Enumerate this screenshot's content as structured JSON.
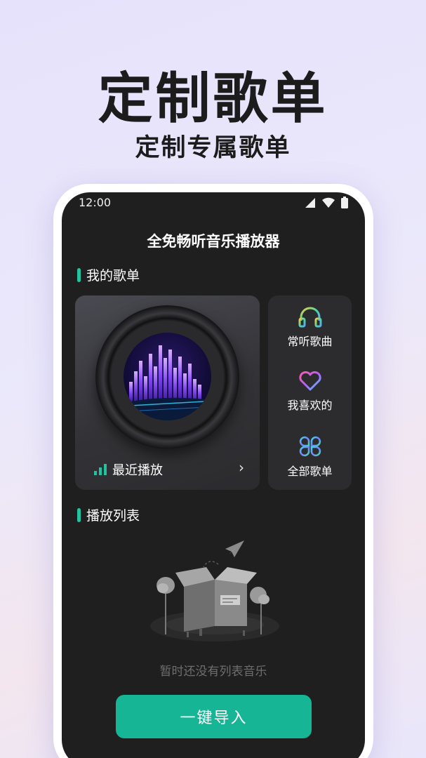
{
  "promo": {
    "headline": "定制歌单",
    "subheadline": "定制专属歌单"
  },
  "status_bar": {
    "time": "12:00",
    "icons": [
      "signal-icon",
      "wifi-icon",
      "battery-icon"
    ]
  },
  "app": {
    "title": "全免畅听音乐播放器"
  },
  "my_playlists": {
    "section_title": "我的歌单",
    "recent": {
      "label": "最近播放",
      "icon": "equalizer-bars-icon",
      "chevron": "›"
    },
    "quick_links": [
      {
        "label": "常听歌曲",
        "icon": "headphones-icon"
      },
      {
        "label": "我喜欢的",
        "icon": "heart-icon"
      },
      {
        "label": "全部歌单",
        "icon": "clover-grid-icon"
      }
    ]
  },
  "play_list": {
    "section_title": "播放列表",
    "empty_text": "暂时还没有列表音乐",
    "import_button": "一键导入"
  },
  "colors": {
    "accent": "#16b596",
    "section_bar": "#22c3a0",
    "screen_bg": "#1f1f1f"
  }
}
